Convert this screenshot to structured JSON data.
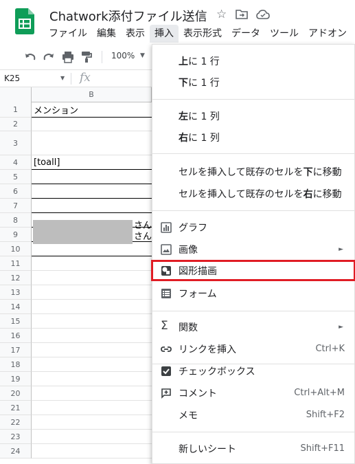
{
  "app": {
    "title": "Chatwork添付ファイル送信"
  },
  "menubar": {
    "items": [
      "ファイル",
      "編集",
      "表示",
      "挿入",
      "表示形式",
      "データ",
      "ツール",
      "アドオン"
    ]
  },
  "toolbar": {
    "zoom": "100%"
  },
  "formula_bar": {
    "name_box": "K25",
    "fx_label": "fx"
  },
  "grid": {
    "column_header": "B",
    "rows": [
      {
        "num": "1",
        "value": "メンション"
      },
      {
        "num": "2",
        "value": ""
      },
      {
        "num": "3",
        "value": ""
      },
      {
        "num": "4",
        "value": "[toall]"
      },
      {
        "num": "5",
        "value": ""
      },
      {
        "num": "6",
        "value": ""
      },
      {
        "num": "7",
        "value": ""
      },
      {
        "num": "8",
        "value": ""
      },
      {
        "num": "9",
        "value": ""
      },
      {
        "num": "10",
        "value": ""
      },
      {
        "num": "11",
        "value": ""
      },
      {
        "num": "12",
        "value": ""
      },
      {
        "num": "13",
        "value": ""
      },
      {
        "num": "14",
        "value": ""
      },
      {
        "num": "15",
        "value": ""
      },
      {
        "num": "16",
        "value": ""
      },
      {
        "num": "17",
        "value": ""
      },
      {
        "num": "18",
        "value": ""
      },
      {
        "num": "19",
        "value": ""
      },
      {
        "num": "20",
        "value": ""
      },
      {
        "num": "21",
        "value": ""
      },
      {
        "num": "22",
        "value": ""
      },
      {
        "num": "23",
        "value": ""
      },
      {
        "num": "24",
        "value": ""
      }
    ],
    "row3_overflow": [
      "さん",
      "さん"
    ]
  },
  "insert_menu": {
    "row_above": {
      "bold": "上",
      "rest": "に 1 行"
    },
    "row_below": {
      "bold": "下",
      "rest": "に 1 行"
    },
    "col_left": {
      "bold": "左",
      "rest": "に 1 列"
    },
    "col_right": {
      "bold": "右",
      "rest": "に 1 列"
    },
    "shift_down": {
      "pre": "セルを挿入して既存のセルを",
      "bold": "下",
      "post": "に移動"
    },
    "shift_right": {
      "pre": "セルを挿入して既存のセルを",
      "bold": "右",
      "post": "に移動"
    },
    "chart": "グラフ",
    "image": "画像",
    "drawing": "図形描画",
    "form": "フォーム",
    "function": "関数",
    "insert_link": "リンクを挿入",
    "insert_link_shortcut": "Ctrl+K",
    "checkbox": "チェックボックス",
    "comment": "コメント",
    "comment_shortcut": "Ctrl+Alt+M",
    "note": "メモ",
    "note_shortcut": "Shift+F2",
    "new_sheet": "新しいシート",
    "new_sheet_shortcut": "Shift+F11"
  },
  "colors": {
    "sheets_green": "#0f9d58",
    "highlight_red": "#e01c24",
    "icon_gray": "#5f6368"
  }
}
